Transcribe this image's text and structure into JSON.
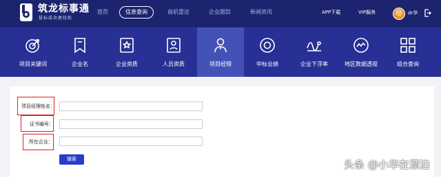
{
  "header": {
    "brand": "筑龙标事通",
    "slogan": "投标成功更轻松",
    "nav": [
      "首页",
      "信息查询",
      "商机雷达",
      "企业跟踪",
      "新闻资讯"
    ],
    "active_nav": "信息查询",
    "app_download": "APP下载",
    "vip": "VIP服务",
    "username": "dr华"
  },
  "categories": [
    {
      "label": "项目关键词",
      "icon": "target-icon"
    },
    {
      "label": "企业名",
      "icon": "bookmark-icon"
    },
    {
      "label": "企业资质",
      "icon": "certificate-icon"
    },
    {
      "label": "人员资质",
      "icon": "id-card-icon"
    },
    {
      "label": "项目经理",
      "icon": "person-icon"
    },
    {
      "label": "中标业绩",
      "icon": "medal-icon"
    },
    {
      "label": "企业下浮率",
      "icon": "trend-icon"
    },
    {
      "label": "地区数据透视",
      "icon": "chart-circle-icon"
    },
    {
      "label": "组合查询",
      "icon": "grid-icon"
    }
  ],
  "active_category": "项目经理",
  "form": {
    "fields": [
      {
        "label": "项目经理姓名：",
        "value": ""
      },
      {
        "label": "证书编号：",
        "value": ""
      },
      {
        "label": "所在企业：",
        "value": ""
      }
    ],
    "search_label": "搜索"
  },
  "watermark": "头条 @小华在漂泊",
  "colors": {
    "topbar": "#1c2470",
    "band": "#283095",
    "active_tab": "#4452b8",
    "button": "#2a3bc9",
    "highlight": "#e01e1e"
  }
}
